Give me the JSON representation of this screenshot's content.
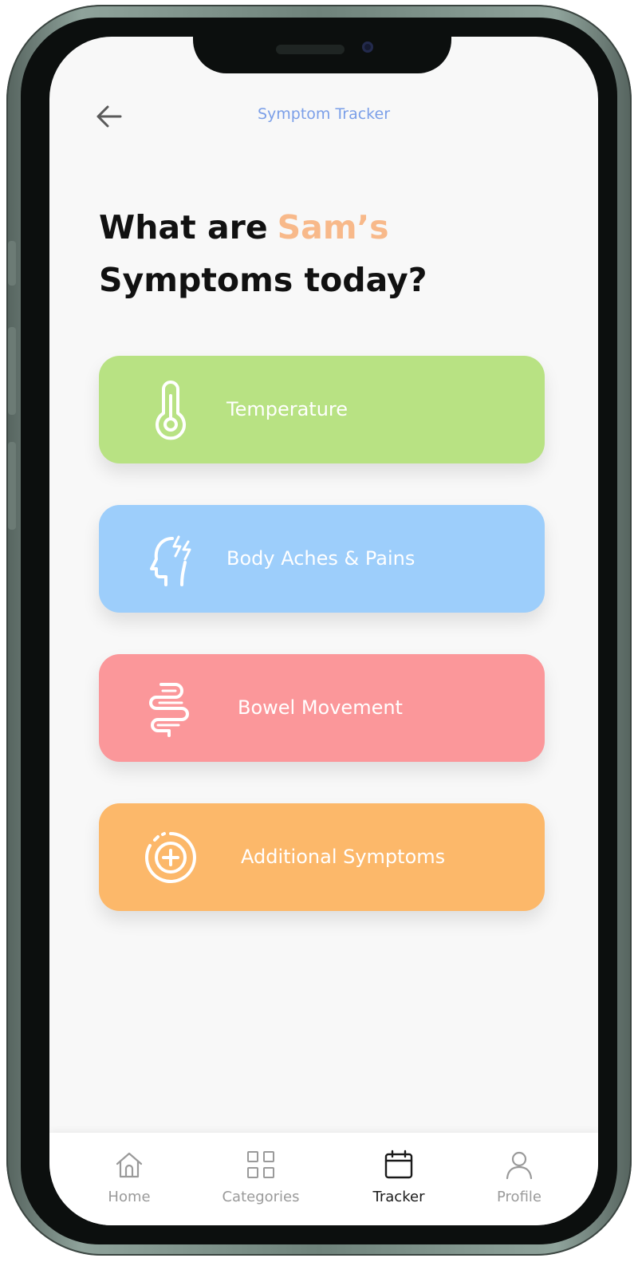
{
  "header": {
    "title": "Symptom Tracker",
    "back_icon": "arrow-left-icon"
  },
  "headline": {
    "line1": "What are",
    "name": "Sam’s",
    "line2": "Symptoms today?"
  },
  "symptoms": [
    {
      "label": "Temperature",
      "icon": "thermometer-icon",
      "color": "#b8e283"
    },
    {
      "label": "Body Aches & Pains",
      "icon": "head-pain-icon",
      "color": "#9dcefb"
    },
    {
      "label": "Bowel Movement",
      "icon": "intestine-icon",
      "color": "#fb979a"
    },
    {
      "label": "Additional Symptoms",
      "icon": "add-circle-icon",
      "color": "#fcb86a"
    }
  ],
  "tabs": [
    {
      "label": "Home",
      "icon": "home-icon"
    },
    {
      "label": "Categories",
      "icon": "grid-icon"
    },
    {
      "label": "Tracker",
      "icon": "calendar-icon",
      "active": true
    },
    {
      "label": "Profile",
      "icon": "user-icon"
    }
  ],
  "colors": {
    "title_blue": "#7b9fe8",
    "accent_name": "#f8b98a"
  }
}
